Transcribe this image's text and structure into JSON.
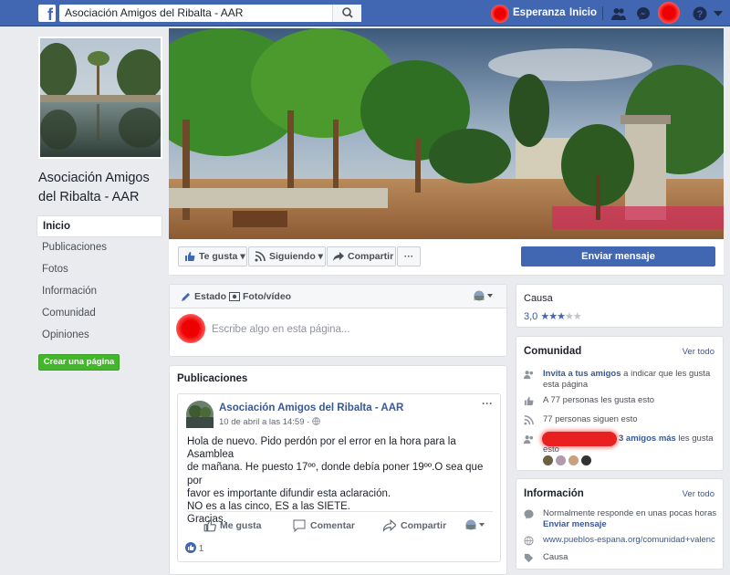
{
  "topbar": {
    "search_value": "Asociación Amigos del Ribalta - AAR",
    "user_name": "Esperanza",
    "home_label": "Inicio"
  },
  "page": {
    "name": "Asociación Amigos del Ribalta - AAR",
    "nav": [
      "Inicio",
      "Publicaciones",
      "Fotos",
      "Información",
      "Comunidad",
      "Opiniones"
    ],
    "create_page": "Crear una página"
  },
  "actions": {
    "like": "Te gusta",
    "following": "Siguiendo",
    "share": "Compartir",
    "more": "···",
    "send_message": "Enviar mensaje"
  },
  "composer": {
    "tab_status": "Estado",
    "tab_photo": "Foto/vídeo",
    "placeholder": "Escribe algo en esta página..."
  },
  "feed": {
    "title": "Publicaciones",
    "post": {
      "author": "Asociación Amigos del Ribalta - AAR",
      "date": "10 de abril a las 14:59 · ",
      "text_lines": [
        "Hola de nuevo. Pido perdón por el error en la hora para la Asamblea",
        "de mañana. He puesto 17ºº, donde debía poner 19ºº.O sea que por",
        "favor es importante difundir esta aclaración.",
        "NO es a las cinco, ES a las SIETE.",
        "Gracias."
      ],
      "like": "Me gusta",
      "comment": "Comentar",
      "share": "Compartir",
      "reactions": "1"
    }
  },
  "sidebar_right": {
    "cause_label": "Causa",
    "rating": "3,0",
    "rating_stars": 3,
    "community": {
      "title": "Comunidad",
      "see_all": "Ver todo",
      "invite_link": "Invita a tus amigos",
      "invite_rest": " a indicar que les gusta",
      "invite_rest2": "esta página",
      "likes": "A 77 personas les gusta esto",
      "follows": "77 personas siguen esto",
      "friends_link": "3 amigos más",
      "friends_rest": " les gusta",
      "friends_rest2": "esto"
    },
    "info": {
      "title": "Información",
      "see_all": "Ver todo",
      "response": "Normalmente responde en unas pocas horas",
      "send_message": "Enviar mensaje",
      "website": "www.pueblos-espana.org/comunidad+valenc",
      "more": "Causa"
    }
  },
  "colors": {
    "brand": "#4267b2",
    "link": "#385898",
    "green": "#42b72a",
    "background": "#e9ebee"
  }
}
